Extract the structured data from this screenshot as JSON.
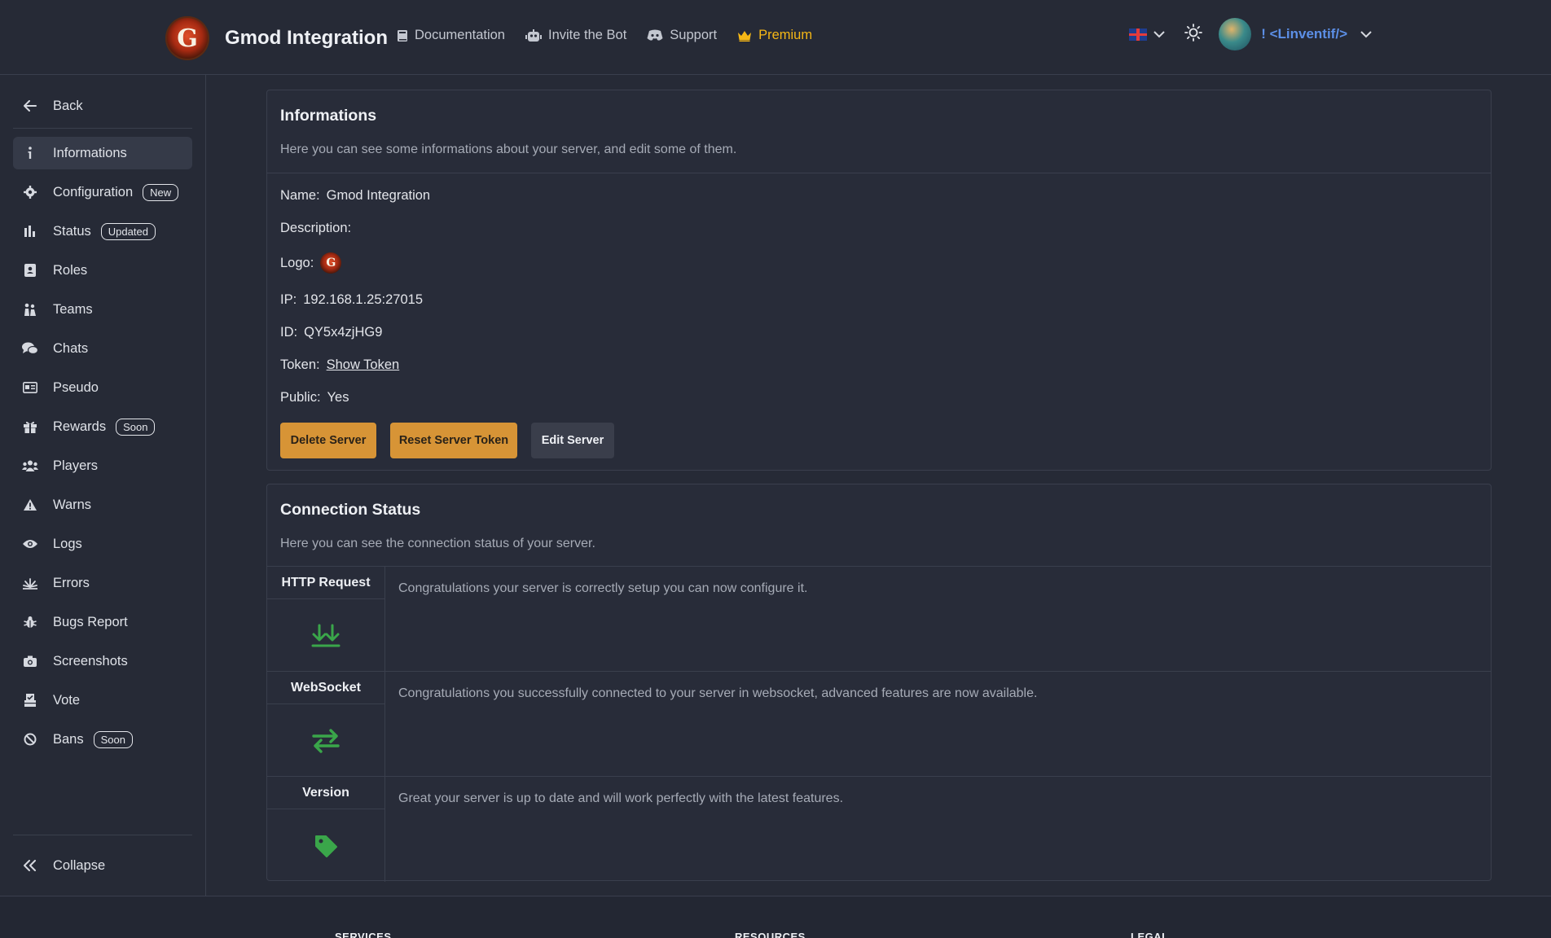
{
  "header": {
    "logo_letter": "G",
    "title": "Gmod Integration",
    "nav": [
      {
        "label": "Documentation",
        "icon": "book-icon"
      },
      {
        "label": "Invite the Bot",
        "icon": "robot-icon"
      },
      {
        "label": "Support",
        "icon": "discord-icon"
      },
      {
        "label": "Premium",
        "icon": "crown-icon",
        "color": "#f5b716"
      }
    ],
    "username": "! <Linventif/>",
    "username_color": "#5c8fe6"
  },
  "sidebar": {
    "back_label": "Back",
    "items": [
      {
        "label": "Informations",
        "icon": "info-icon",
        "active": true
      },
      {
        "label": "Configuration",
        "icon": "gear-icon",
        "badge": "New"
      },
      {
        "label": "Status",
        "icon": "bar-chart-icon",
        "badge": "Updated"
      },
      {
        "label": "Roles",
        "icon": "id-card-icon"
      },
      {
        "label": "Teams",
        "icon": "people-icon"
      },
      {
        "label": "Chats",
        "icon": "chat-bubbles-icon"
      },
      {
        "label": "Pseudo",
        "icon": "name-card-icon"
      },
      {
        "label": "Rewards",
        "icon": "gift-icon",
        "badge": "Soon"
      },
      {
        "label": "Players",
        "icon": "users-icon"
      },
      {
        "label": "Warns",
        "icon": "warning-icon"
      },
      {
        "label": "Logs",
        "icon": "eye-icon"
      },
      {
        "label": "Errors",
        "icon": "burst-icon"
      },
      {
        "label": "Bugs Report",
        "icon": "bug-icon"
      },
      {
        "label": "Screenshots",
        "icon": "camera-icon"
      },
      {
        "label": "Vote",
        "icon": "vote-icon"
      },
      {
        "label": "Bans",
        "icon": "ban-icon",
        "badge": "Soon"
      }
    ],
    "collapse_label": "Collapse"
  },
  "info_card": {
    "title": "Informations",
    "subtitle": "Here you can see some informations about your server, and edit some of them.",
    "name_label": "Name:",
    "name_value": "Gmod Integration",
    "description_label": "Description:",
    "description_value": "",
    "logo_label": "Logo:",
    "ip_label": "IP:",
    "ip_value": "192.168.1.25:27015",
    "id_label": "ID:",
    "id_value": "QY5x4zjHG9",
    "token_label": "Token:",
    "token_link": "Show Token",
    "public_label": "Public:",
    "public_value": "Yes",
    "buttons": {
      "delete": "Delete Server",
      "reset": "Reset Server Token",
      "edit": "Edit Server"
    },
    "accent_color": "#d79436"
  },
  "connection_card": {
    "title": "Connection Status",
    "subtitle": "Here you can see the connection status of your server.",
    "rows": [
      {
        "label": "HTTP Request",
        "icon": "double-down-arrow-icon",
        "text": "Congratulations your server is correctly setup you can now configure it."
      },
      {
        "label": "WebSocket",
        "icon": "exchange-arrows-icon",
        "text": "Congratulations you successfully connected to your server in websocket, advanced features are now available."
      },
      {
        "label": "Version",
        "icon": "tag-icon",
        "text": "Great your server is up to date and will work perfectly with the latest features."
      }
    ],
    "status_color": "#3aa64a"
  },
  "footer": {
    "columns": [
      "SERVICES",
      "RESOURCES",
      "LEGAL"
    ]
  }
}
